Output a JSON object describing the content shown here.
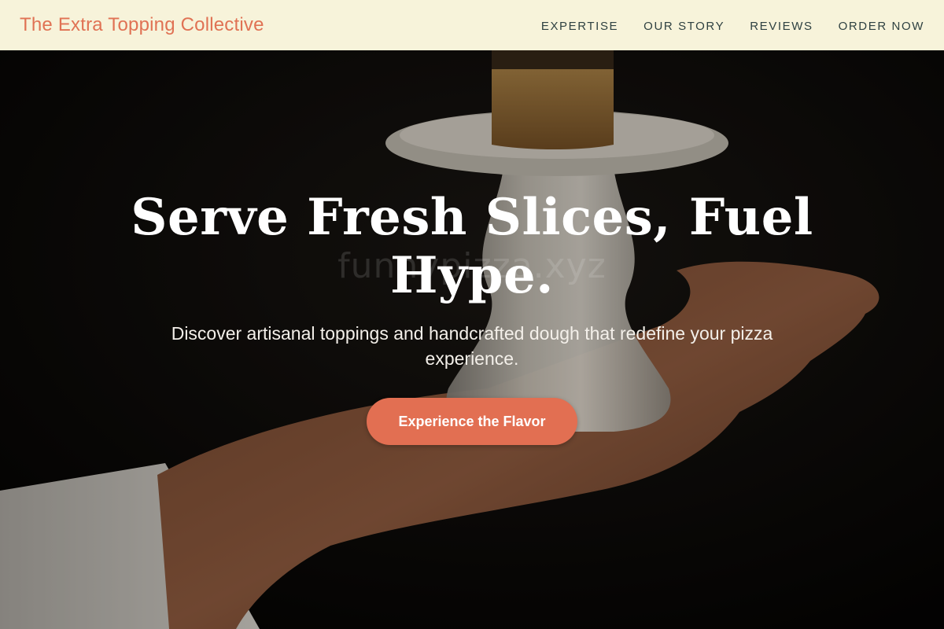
{
  "colors": {
    "nav_background": "#f7f3da",
    "brand": "#e07254",
    "nav_link": "#2f4141",
    "accent": "#e26f52",
    "hero_text": "#ffffff"
  },
  "nav": {
    "brand": "The Extra Topping Collective",
    "links": [
      {
        "label": "EXPERTISE"
      },
      {
        "label": "OUR STORY"
      },
      {
        "label": "REVIEWS"
      },
      {
        "label": "ORDER NOW"
      }
    ]
  },
  "hero": {
    "title": "Serve Fresh Slices, Fuel Hype.",
    "subtitle": "Discover artisanal toppings and handcrafted dough that redefine your pizza experience.",
    "cta_label": "Experience the Flavor",
    "watermark": "funnypizza.xyz"
  }
}
